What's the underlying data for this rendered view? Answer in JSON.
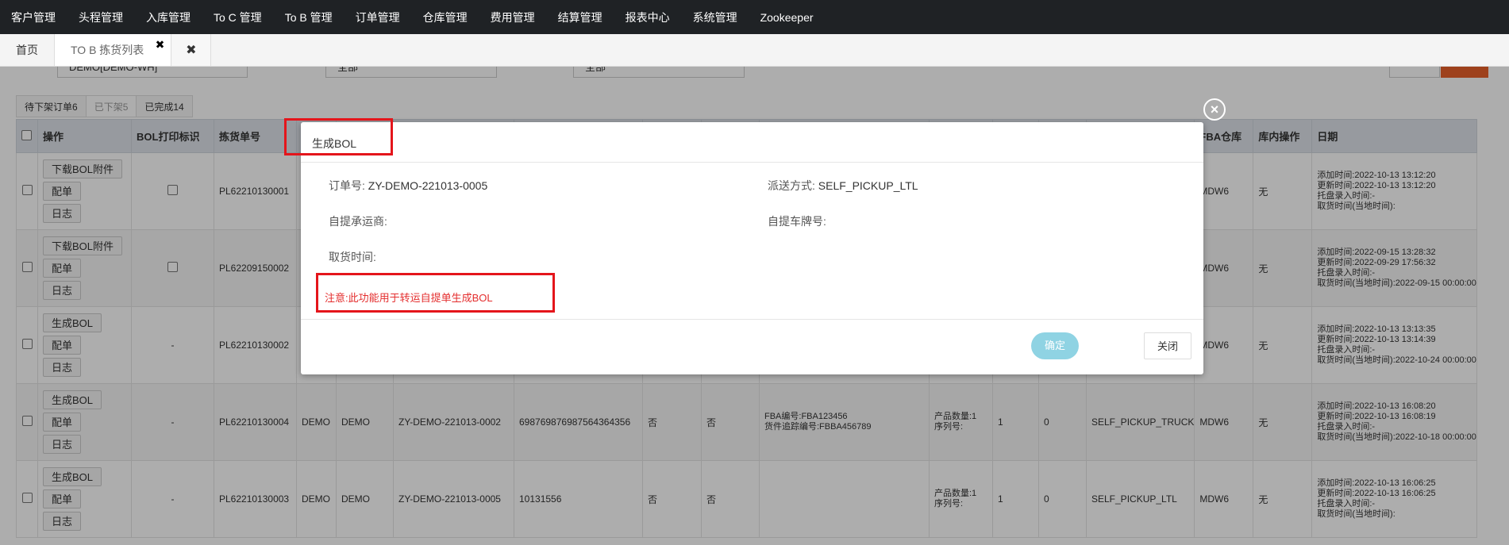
{
  "nav": [
    "客户管理",
    "头程管理",
    "入库管理",
    "To C 管理",
    "To B 管理",
    "订单管理",
    "仓库管理",
    "费用管理",
    "结算管理",
    "报表中心",
    "系统管理",
    "Zookeeper"
  ],
  "tabs": {
    "home": "首页",
    "active": "TO B 拣货列表",
    "close_mark": "✖"
  },
  "filters": {
    "field1_value": "DEMO[DEMO-WH]",
    "field2_value": "全部",
    "field3_value": "全部"
  },
  "status_tabs": [
    "待下架订单6",
    "已下架5",
    "已完成14"
  ],
  "table": {
    "headers": [
      "操作",
      "BOL打印标识",
      "拣货单号",
      "",
      "",
      "",
      "",
      "",
      "",
      "",
      "",
      "",
      "",
      "",
      "",
      "FBA仓库",
      "库内操作",
      "日期"
    ],
    "rows": [
      {
        "btn1": "下载BOL附件",
        "btn2": "配单",
        "btn3": "日志",
        "bol": "checkbox",
        "pick_no": "PL62210130001",
        "c1": "",
        "c2": "",
        "order": "",
        "track": "",
        "f1": "",
        "f2": "",
        "fba_info": [
          "",
          ""
        ],
        "prod": [
          "",
          ""
        ],
        "q1": "",
        "q2": "",
        "ship": "",
        "fba_wh": "MDW6",
        "op": "无",
        "dates": [
          "添加时间:2022-10-13 13:12:20",
          "更新时间:2022-10-13 13:12:20",
          "托盘录入时间:-",
          "取货时间(当地时间):"
        ]
      },
      {
        "btn1": "下载BOL附件",
        "btn2": "配单",
        "btn3": "日志",
        "bol": "checkbox",
        "pick_no": "PL62209150002",
        "c1": "",
        "c2": "",
        "order": "",
        "track": "",
        "f1": "",
        "f2": "",
        "fba_info": [
          "",
          ""
        ],
        "prod": [
          "",
          ""
        ],
        "q1": "",
        "q2": "",
        "ship": "",
        "fba_wh": "MDW6",
        "op": "无",
        "dates": [
          "添加时间:2022-09-15 13:28:32",
          "更新时间:2022-09-29 17:56:32",
          "托盘录入时间:-",
          "取货时间(当地时间):2022-09-15 00:00:00"
        ]
      },
      {
        "btn1": "生成BOL",
        "btn2": "配单",
        "btn3": "日志",
        "bol": "-",
        "pick_no": "PL62210130002",
        "c1": "",
        "c2": "",
        "order": "",
        "track": "",
        "f1": "",
        "f2": "",
        "fba_info": [
          "",
          ""
        ],
        "prod": [
          "",
          ""
        ],
        "q1": "",
        "q2": "",
        "ship": "",
        "fba_wh": "MDW6",
        "op": "无",
        "dates": [
          "添加时间:2022-10-13 13:13:35",
          "更新时间:2022-10-13 13:14:39",
          "托盘录入时间:-",
          "取货时间(当地时间):2022-10-24 00:00:00"
        ]
      },
      {
        "btn1": "生成BOL",
        "btn2": "配单",
        "btn3": "日志",
        "bol": "-",
        "pick_no": "PL62210130004",
        "c1": "DEMO",
        "c2": "DEMO",
        "order": "ZY-DEMO-221013-0002",
        "track": "69876987698756436435​6",
        "f1": "否",
        "f2": "否",
        "fba_info": [
          "FBA编号:FBA123456",
          "货件追踪编号:FBBA456789"
        ],
        "prod": [
          "产品数量:1",
          "序列号:"
        ],
        "q1": "1",
        "q2": "0",
        "ship": "SELF_PICKUP_TRUCK",
        "fba_wh": "MDW6",
        "op": "无",
        "dates": [
          "添加时间:2022-10-13 16:08:20",
          "更新时间:2022-10-13 16:08:19",
          "托盘录入时间:-",
          "取货时间(当地时间):2022-10-18 00:00:00"
        ]
      },
      {
        "btn1": "生成BOL",
        "btn2": "配单",
        "btn3": "日志",
        "bol": "-",
        "pick_no": "PL62210130003",
        "c1": "DEMO",
        "c2": "DEMO",
        "order": "ZY-DEMO-221013-0005",
        "track": "10131556",
        "f1": "否",
        "f2": "否",
        "fba_info": [
          "",
          ""
        ],
        "prod": [
          "产品数量:1",
          "序列号:"
        ],
        "q1": "1",
        "q2": "0",
        "ship": "SELF_PICKUP_LTL",
        "fba_wh": "MDW6",
        "op": "无",
        "dates": [
          "添加时间:2022-10-13 16:06:25",
          "更新时间:2022-10-13 16:06:25",
          "托盘录入时间:-",
          "取货时间(当地时间):"
        ]
      }
    ]
  },
  "modal": {
    "title": "生成BOL",
    "order_no_label": "订单号:",
    "order_no_value": "ZY-DEMO-221013-0005",
    "delivery_label": "派送方式:",
    "delivery_value": "SELF_PICKUP_LTL",
    "carrier_label": "自提承运商:",
    "plate_label": "自提车牌号:",
    "pickup_time_label": "取货时间:",
    "notice": "注意:此功能用于转运自提单生成BOL",
    "ok_label": "确定",
    "close_label": "关闭",
    "x_mark": "×"
  },
  "colors": {
    "nav_bg": "#1f2225",
    "highlight": "#e4151b",
    "notice": "#e42e2e",
    "ok_button": "#8fd3e3",
    "link": "#1a7bd0"
  }
}
